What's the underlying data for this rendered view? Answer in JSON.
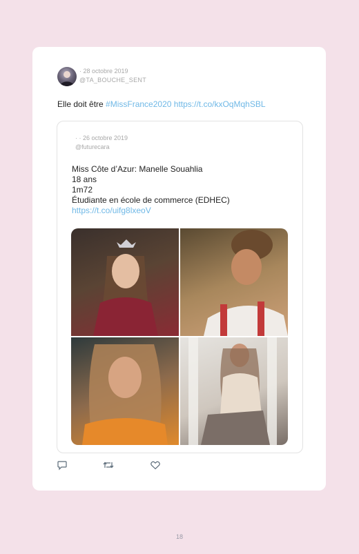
{
  "tweet": {
    "date": "· 28 octobre 2019",
    "handle": "@TA_BOUCHE_SENT",
    "text": "Elle doit être",
    "hashtag": "#MissFrance2020",
    "link": "https://t.co/kxOqMqhSBL"
  },
  "quoted": {
    "date": "· · 26 octobre 2019",
    "handle": "@futurecara",
    "lines": [
      "Miss Côte d’Azur: Manelle Souahlia",
      "18 ans",
      "1m72",
      "Étudiante en école de commerce (EDHEC)"
    ],
    "link": "https://t.co/uifg8lxeoV"
  },
  "actions": {
    "reply_icon": "reply-icon",
    "retweet_icon": "retweet-icon",
    "like_icon": "heart-icon"
  },
  "page_number": "18"
}
